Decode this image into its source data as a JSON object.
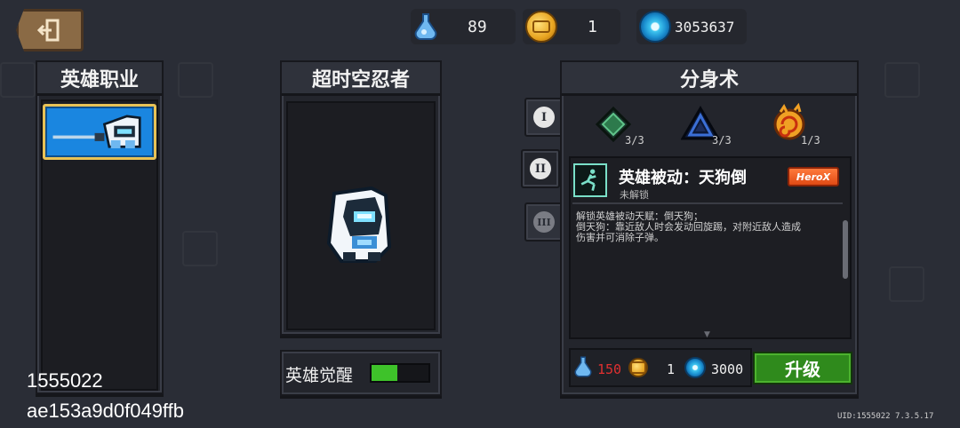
{
  "topbar": {
    "back_icon": "exit-door-icon",
    "energy": "89",
    "gold": "1",
    "gems": "3053637"
  },
  "left_panel": {
    "title": "英雄职业"
  },
  "center_panel": {
    "title": "超时空忍者",
    "awaken_label": "英雄觉醒",
    "awaken_progress": 0.45
  },
  "overlay": {
    "uid": "1555022",
    "hash": "ae153a9d0f049ffb"
  },
  "skill_tabs": {
    "tab1": "I",
    "tab2": "II",
    "tab3": "III"
  },
  "skill_panel": {
    "title": "分身术",
    "skills": [
      {
        "icon": "green-diamond-icon",
        "count": "3/3"
      },
      {
        "icon": "blue-triangle-icon",
        "count": "3/3"
      },
      {
        "icon": "fire-spiral-icon",
        "count": "1/3"
      }
    ],
    "passive_title": "英雄被动：天狗倒",
    "passive_status": "未解锁",
    "badge": "HeroX",
    "description_lines": [
      "解锁英雄被动天赋：倒天狗；",
      "倒天狗：靠近敌人时会发动回旋踢，对附近敌人造成",
      "伤害并可消除子弹。"
    ],
    "cost": {
      "energy": "150",
      "gold": "1",
      "gems": "3000"
    },
    "upgrade_label": "升级"
  },
  "footer": {
    "uid_version": "UID:1555022 7.3.5.17"
  },
  "colors": {
    "background": "#2a2d36",
    "accent_blue": "#1a86e0",
    "upgrade_green": "#2f8a1c",
    "cost_red": "#e03030"
  }
}
